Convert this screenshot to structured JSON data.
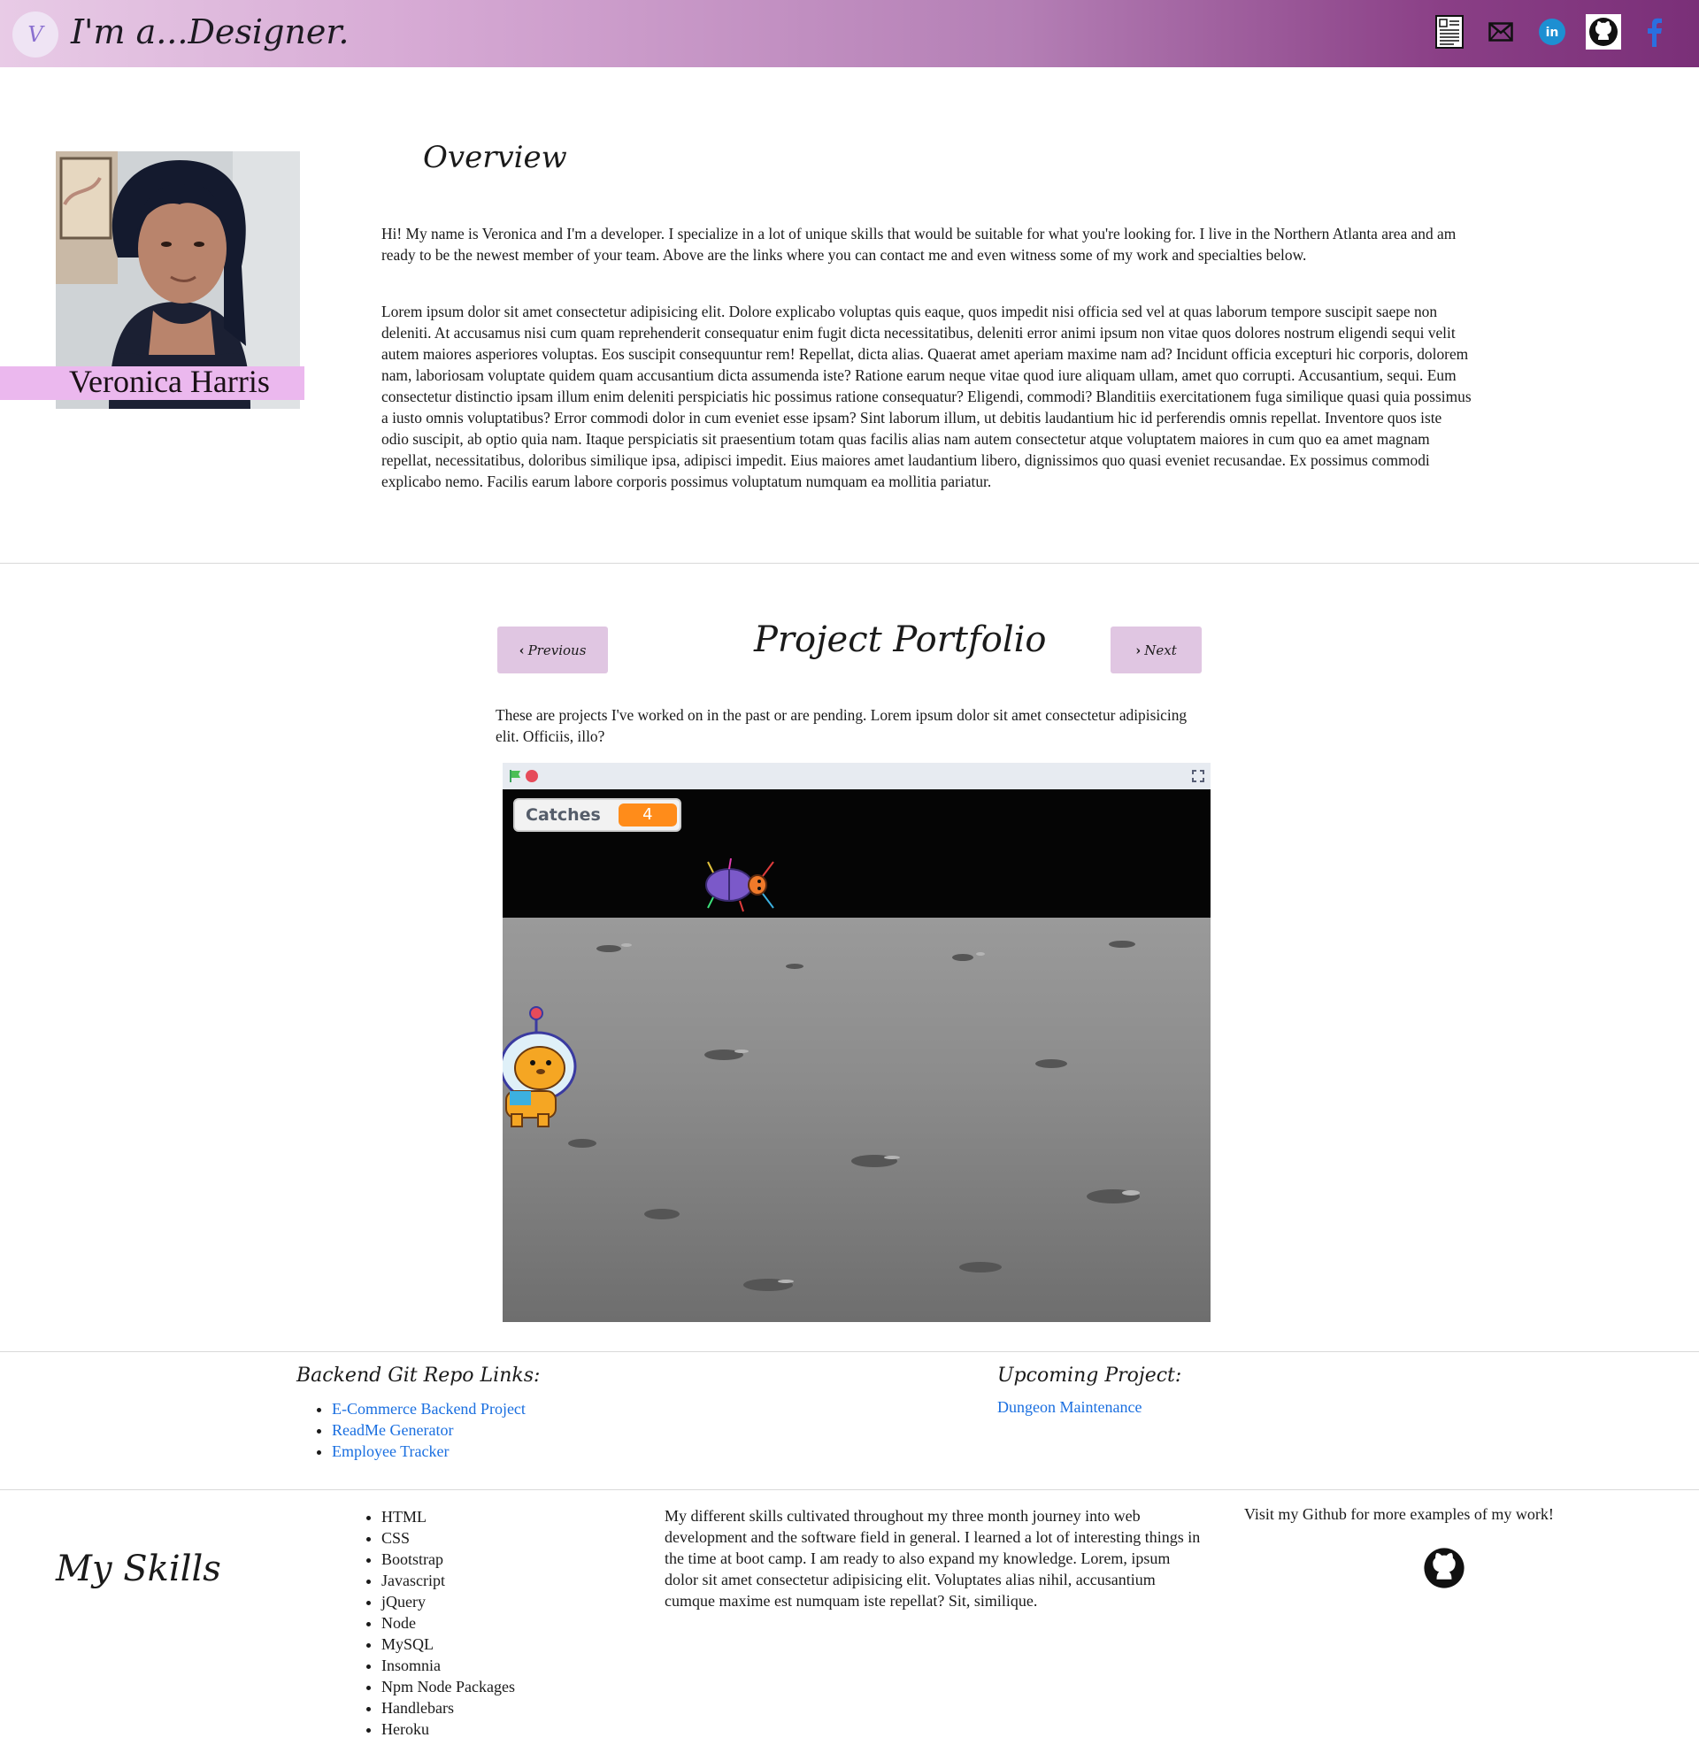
{
  "header": {
    "logo_text": "V",
    "brand": "I'm a...Designer.",
    "icons": [
      "resume-icon",
      "mail-icon",
      "linkedin-icon",
      "github-icon",
      "facebook-icon"
    ],
    "gradient_start": "#e8cbe6",
    "gradient_end": "#7a2f78"
  },
  "overview": {
    "title": "Overview",
    "name": "Veronica Harris",
    "paragraph1": "Hi! My name is Veronica and I'm a developer. I specialize in a lot of unique skills that would be suitable for what you're looking for. I live in the Northern Atlanta area and am ready to be the newest member of your team. Above are the links where you can contact me and even witness some of my work and specialties below.",
    "paragraph2": "Lorem ipsum dolor sit amet consectetur adipisicing elit. Dolore explicabo voluptas quis eaque, quos impedit nisi officia sed vel at quas laborum tempore suscipit saepe non deleniti. At accusamus nisi cum quam reprehenderit consequatur enim fugit dicta necessitatibus, deleniti error animi ipsum non vitae quos dolores nostrum eligendi sequi velit autem maiores asperiores voluptas. Eos suscipit consequuntur rem! Repellat, dicta alias. Quaerat amet aperiam maxime nam ad? Incidunt officia excepturi hic corporis, dolorem nam, laboriosam voluptate quidem quam accusantium dicta assumenda iste? Ratione earum neque vitae quod iure aliquam ullam, amet quo corrupti. Accusantium, sequi. Eum consectetur distinctio ipsam illum enim deleniti perspiciatis hic possimus ratione consequatur? Eligendi, commodi? Blanditiis exercitationem fuga similique quasi quia possimus a iusto omnis voluptatibus? Error commodi dolor in cum eveniet esse ipsam? Sint laborum illum, ut debitis laudantium hic id perferendis omnis repellat. Inventore quos iste odio suscipit, ab optio quia nam. Itaque perspiciatis sit praesentium totam quas facilis alias nam autem consectetur atque voluptatem maiores in cum quo ea amet magnam repellat, necessitatibus, doloribus similique ipsa, adipisci impedit. Eius maiores amet laudantium libero, dignissimos quo quasi eveniet recusandae. Ex possimus commodi explicabo nemo. Facilis earum labore corporis possimus voluptatum numquam ea mollitia pariatur."
  },
  "portfolio": {
    "title": "Project Portfolio",
    "prev_label": "Previous",
    "next_label": "Next",
    "description": "These are projects I've worked on in the past or are pending. Lorem ipsum dolor sit amet consectetur adipisicing elit. Officiis, illo?",
    "game": {
      "counter_label": "Catches",
      "counter_value": "4"
    }
  },
  "links": {
    "backend_title": "Backend Git Repo Links:",
    "backend_items": [
      "E-Commerce Backend Project",
      "ReadMe Generator",
      "Employee Tracker"
    ],
    "upcoming_title": "Upcoming Project:",
    "upcoming_link": "Dungeon Maintenance",
    "link_color": "#1a6fe0"
  },
  "skills": {
    "title": "My Skills",
    "items": [
      "HTML",
      "CSS",
      "Bootstrap",
      "Javascript",
      "jQuery",
      "Node",
      "MySQL",
      "Insomnia",
      "Npm Node Packages",
      "Handlebars",
      "Heroku"
    ],
    "description": "My different skills cultivated throughout my three month journey into web development and the software field in general. I learned a lot of interesting things in the time at boot camp. I am ready to also expand my knowledge. Lorem, ipsum dolor sit amet consectetur adipisicing elit. Voluptates alias nihil, accusantium cumque maxime est numquam iste repellat? Sit, similique.",
    "github_note": "Visit my Github for more examples of my work!"
  }
}
